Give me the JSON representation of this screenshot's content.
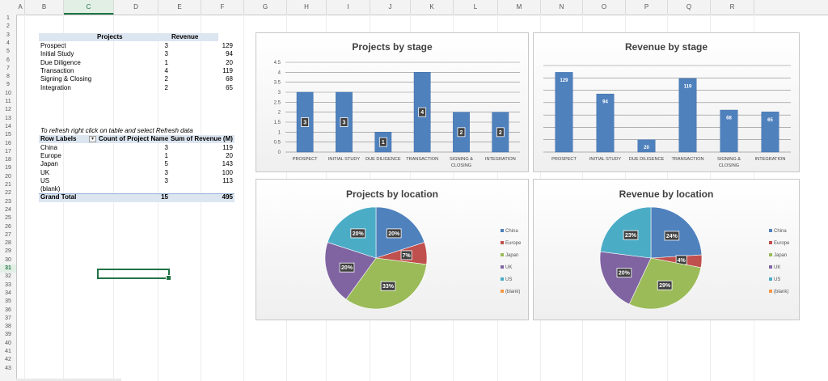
{
  "sheet": {
    "columns": [
      "A",
      "B",
      "C",
      "D",
      "E",
      "F",
      "G",
      "H",
      "I",
      "J",
      "K",
      "L",
      "M",
      "N",
      "O",
      "P",
      "Q",
      "R"
    ],
    "selected_column": "C",
    "row_count": 43,
    "selected_row": 31,
    "colors": {
      "header_band": "#dce6f1",
      "accent": "#217346",
      "bar": "#4f81bd"
    }
  },
  "table1": {
    "headers": [
      "Projects",
      "Revenue"
    ],
    "rows": [
      {
        "stage": "Prospect",
        "projects": "3",
        "revenue": "129"
      },
      {
        "stage": "Initial Study",
        "projects": "3",
        "revenue": "94"
      },
      {
        "stage": "Due Diligence",
        "projects": "1",
        "revenue": "20"
      },
      {
        "stage": "Transaction",
        "projects": "4",
        "revenue": "119"
      },
      {
        "stage": "Signing & Closing",
        "projects": "2",
        "revenue": "68"
      },
      {
        "stage": "Integration",
        "projects": "2",
        "revenue": "65"
      }
    ]
  },
  "pivot": {
    "note": "To refresh right click on table and select Refresh data",
    "headers": [
      "Row Labels",
      "Count of Project Name",
      "Sum of Revenue (M)"
    ],
    "rows": [
      {
        "label": "China",
        "count": "3",
        "sum": "119"
      },
      {
        "label": "Europe",
        "count": "1",
        "sum": "20"
      },
      {
        "label": "Japan",
        "count": "5",
        "sum": "143"
      },
      {
        "label": "UK",
        "count": "3",
        "sum": "100"
      },
      {
        "label": "US",
        "count": "3",
        "sum": "113"
      },
      {
        "label": "(blank)",
        "count": "",
        "sum": ""
      }
    ],
    "total": {
      "label": "Grand Total",
      "count": "15",
      "sum": "495"
    }
  },
  "chart_data": [
    {
      "type": "bar",
      "title": "Projects by stage",
      "categories": [
        "PROSPECT",
        "INITIAL STUDY",
        "DUE DILIGENCE",
        "TRANSACTION",
        "SIGNING & CLOSING",
        "INTEGRATION"
      ],
      "values": [
        3,
        3,
        1,
        4,
        2,
        2
      ],
      "yticks": [
        "0",
        "0.5",
        "1",
        "1.5",
        "2",
        "2.5",
        "3",
        "3.5",
        "4",
        "4.5"
      ],
      "ylim": [
        0,
        4.5
      ],
      "grid": true
    },
    {
      "type": "bar",
      "title": "Revenue by stage",
      "categories": [
        "PROSPECT",
        "INITIAL STUDY",
        "DUE DILIGENCE",
        "TRANSACTION",
        "SIGNING & CLOSING",
        "INTEGRATION"
      ],
      "values": [
        129,
        94,
        20,
        119,
        68,
        65
      ],
      "ylim": [
        0,
        140
      ],
      "grid": true
    },
    {
      "type": "pie",
      "title": "Projects by location",
      "labels": [
        "China",
        "Europe",
        "Japan",
        "UK",
        "US",
        "(blank)"
      ],
      "values": [
        20,
        7,
        33,
        20,
        20,
        0
      ],
      "data_labels": [
        "20%",
        "7%",
        "33%",
        "20%",
        "20%",
        ""
      ],
      "colors": [
        "#4f81bd",
        "#c0504d",
        "#9bbb59",
        "#8064a2",
        "#4bacc6",
        "#f79646"
      ],
      "legend": "right"
    },
    {
      "type": "pie",
      "title": "Revenue by location",
      "labels": [
        "China",
        "Europe",
        "Japan",
        "UK",
        "US",
        "(blank)"
      ],
      "values": [
        24,
        4,
        29,
        20,
        23,
        0
      ],
      "data_labels": [
        "24%",
        "4%",
        "29%",
        "20%",
        "23%",
        ""
      ],
      "colors": [
        "#4f81bd",
        "#c0504d",
        "#9bbb59",
        "#8064a2",
        "#4bacc6",
        "#f79646"
      ],
      "legend": "right"
    }
  ]
}
